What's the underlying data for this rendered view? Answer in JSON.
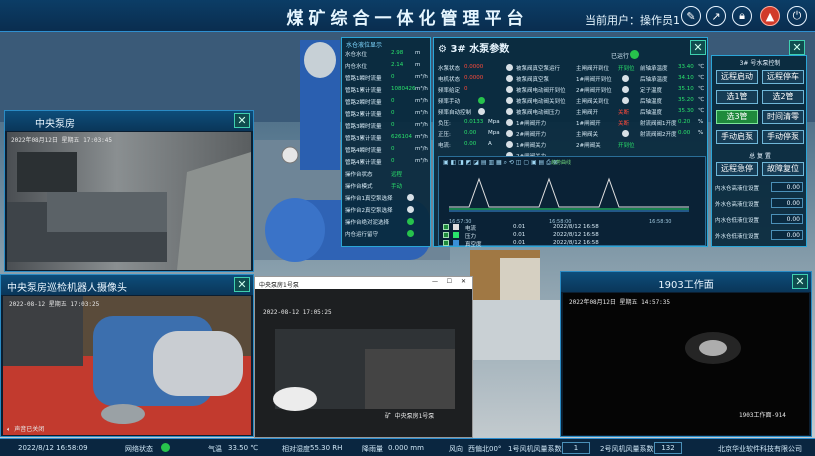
{
  "header": {
    "title": "煤矿综合一体化管理平台",
    "user_label": "当前用户：",
    "user_name": "操作员1"
  },
  "top_icons": [
    "edit-icon",
    "chart-icon",
    "lock-icon",
    "alarm-icon",
    "power-icon"
  ],
  "central_pump_room": {
    "title": "中央泵房",
    "timestamp": "2022年08月12日 星期五 17:03:45"
  },
  "inspection_robot_cam": {
    "title": "中央泵房巡检机器人摄像头",
    "timestamp": "2022-08-12 星期五 17:03:25",
    "audio_status": "声音已关闭"
  },
  "video_player": {
    "title": "中央泵房1号泵",
    "timestamp": "2022-08-12 17:05:25",
    "caption": "矿 中央泵房1号泵"
  },
  "work_face": {
    "title": "1903工作面",
    "timestamp": "2022年08月12日 星期五 14:57:35",
    "caption": "1903工作面-914"
  },
  "pump_status": {
    "title": "水仓液位显示",
    "rows": [
      {
        "label": "水仓水位",
        "value": "2.98",
        "unit": "m"
      },
      {
        "label": "内仓水位",
        "value": "2.14",
        "unit": "m"
      },
      {
        "label": "管路1瞬时流量",
        "value": "0",
        "unit": "m³/h"
      },
      {
        "label": "管路1累计流量",
        "value": "1080426",
        "unit": "m³/h"
      },
      {
        "label": "管路2瞬时流量",
        "value": "0",
        "unit": "m³/h"
      },
      {
        "label": "管路2累计流量",
        "value": "0",
        "unit": "m³/h"
      },
      {
        "label": "管路3瞬时流量",
        "value": "0",
        "unit": "m³/h"
      },
      {
        "label": "管路3累计流量",
        "value": "626104",
        "unit": "m³/h"
      },
      {
        "label": "管路4瞬时流量",
        "value": "0",
        "unit": "m³/h"
      },
      {
        "label": "管路4累计流量",
        "value": "0",
        "unit": "m³/h"
      },
      {
        "label": "操作台状态",
        "value": "远程"
      },
      {
        "label": "操作台模式",
        "value": "手动"
      },
      {
        "label": "操作台1真空泵选择",
        "value": ""
      },
      {
        "label": "操作台2真空泵选择",
        "value": ""
      },
      {
        "label": "操作台绝对泥选择",
        "value": ""
      },
      {
        "label": "内仓运行留守",
        "value": ""
      }
    ]
  },
  "pump_params": {
    "title": "3# 水泵参数",
    "status_label": "已运行",
    "col1": [
      {
        "label": "水泵状态",
        "value": "0.0000"
      },
      {
        "label": "电机状态",
        "value": "0.0000"
      },
      {
        "label": "频率给定",
        "value": "0"
      },
      {
        "label": "频率手动",
        "value": ""
      },
      {
        "label": "频率自动控制",
        "value": ""
      },
      {
        "label": "负压:",
        "value": "0.0133",
        "unit": "Mpa"
      },
      {
        "label": "正压:",
        "value": "0.00",
        "unit": "Mpa"
      },
      {
        "label": "电流:",
        "value": "0.00",
        "unit": "A"
      }
    ],
    "col2": [
      "被泵阀真空泵运行",
      "被泵阀真空泵",
      "被泵阀电动阀开到位",
      "被泵阀电动阀关到位",
      "被泵阀电动阀压力",
      "1#闸阀开力",
      "2#闸阀开力",
      "1#闸阀关力",
      "2#闸阀关力"
    ],
    "col3": [
      {
        "label": "主闸阀开到位",
        "value": "开到位"
      },
      {
        "label": "1#闸阀开到位",
        "value": ""
      },
      {
        "label": "2#闸阀开到位",
        "value": ""
      },
      {
        "label": "主闸阀关到位",
        "value": ""
      },
      {
        "label": "主闸阀开",
        "value": "关断"
      },
      {
        "label": "1#闸阀开",
        "value": "关断"
      },
      {
        "label": "主闸阀关",
        "value": ""
      },
      {
        "label": "2#闸阀关",
        "value": "开到位"
      }
    ],
    "col4": [
      {
        "label": "前轴承温度",
        "value": "33.40",
        "unit": "℃"
      },
      {
        "label": "后轴承温度",
        "value": "34.10",
        "unit": "℃"
      },
      {
        "label": "定子温度",
        "value": "35.10",
        "unit": "℃"
      },
      {
        "label": "后轴温度",
        "value": "35.20",
        "unit": "℃"
      },
      {
        "label": "后轴温度",
        "value": "35.30",
        "unit": "℃"
      },
      {
        "label": "射流阀阀1开度",
        "value": "0.20",
        "unit": "%"
      },
      {
        "label": "射流阀阀2开度",
        "value": "0.00",
        "unit": "%"
      }
    ],
    "trend_label": "趋势曲线",
    "legend": [
      {
        "name": "电流",
        "value": "0.01",
        "time": "2022/8/12 16:58"
      },
      {
        "name": "压力",
        "value": "0.01",
        "time": "2022/8/12 16:58"
      },
      {
        "name": "真空度",
        "value": "0.01",
        "time": "2022/8/12 16:58"
      }
    ],
    "time_axis": [
      "16:57:30",
      "16:58:00",
      "16:58:30"
    ]
  },
  "control": {
    "title": "3# 号水泵控制",
    "buttons": [
      "远程启动",
      "远程停车",
      "选1管",
      "选2管",
      "选3管",
      "时间清零",
      "手动启泵",
      "手动停泵"
    ],
    "reset_title": "总 复 置",
    "reset_buttons": [
      "远程急停",
      "故障复位"
    ],
    "setpoints": [
      {
        "label": "内水仓高液位设置",
        "value": "0.00"
      },
      {
        "label": "外水仓高液位设置",
        "value": "0.00"
      },
      {
        "label": "内水仓低液位设置",
        "value": "0.00"
      },
      {
        "label": "外水仓低液位设置",
        "value": "0.00"
      }
    ]
  },
  "footer": {
    "datetime": "2022/8/12 16:58:09",
    "net_label": "网络状态",
    "pressure_label": "气温",
    "pressure_value": "33.50 ℃",
    "humidity_label": "相对湿度",
    "humidity_value": "55.30 RH",
    "rain_label": "降雨量",
    "rain_value": "0.000 mm",
    "wind_label": "风向",
    "wind_value": "西偏北00°",
    "fan1_label": "1号风机风量系数",
    "fan1_value": "1",
    "fan2_label": "2号风机风量系数",
    "fan2_value": "132",
    "company": "北京华业软件科技有限公司"
  }
}
